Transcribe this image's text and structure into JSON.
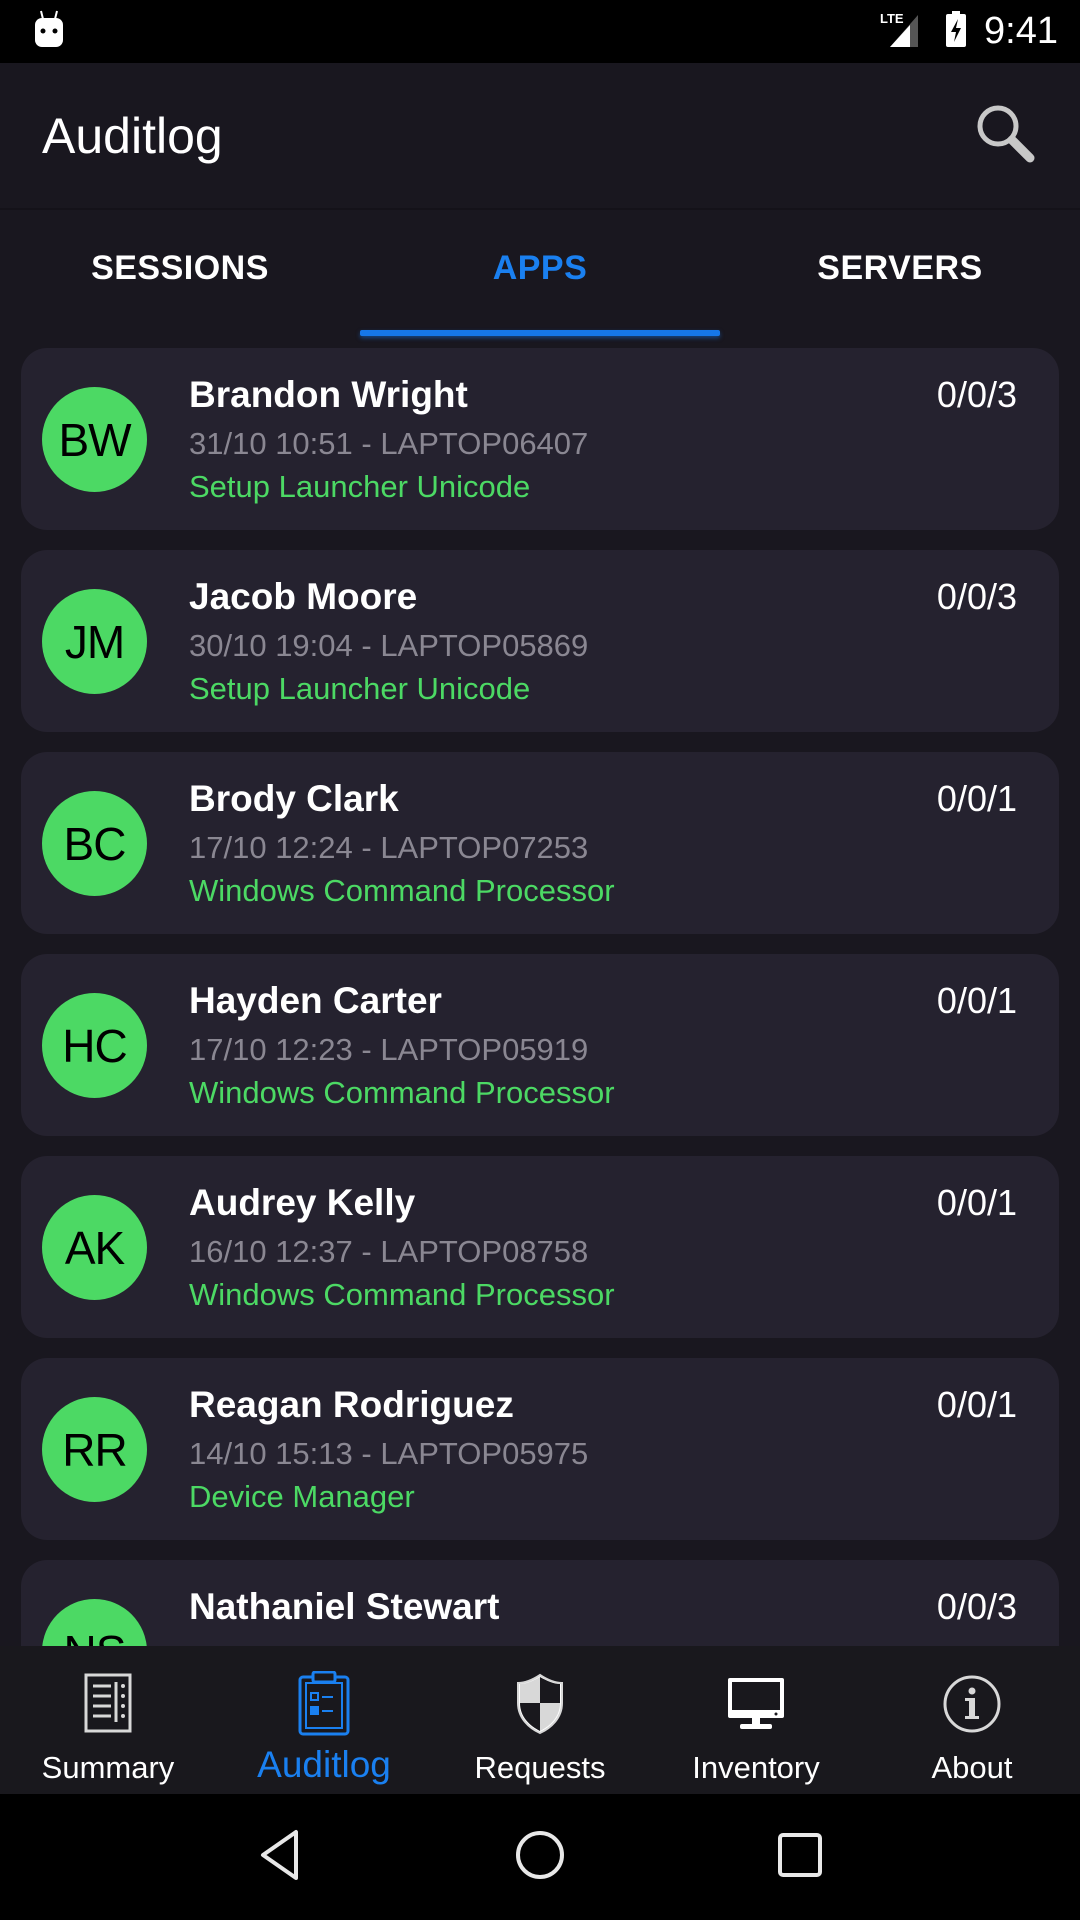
{
  "status_bar": {
    "network": "LTE",
    "time": "9:41"
  },
  "app_bar": {
    "title": "Auditlog",
    "search_icon": "search-icon"
  },
  "tabs": [
    {
      "label": "SESSIONS",
      "active": false
    },
    {
      "label": "APPS",
      "active": true
    },
    {
      "label": "SERVERS",
      "active": false
    }
  ],
  "entries": [
    {
      "initials": "BW",
      "name": "Brandon Wright",
      "meta": "31/10 10:51 - LAPTOP06407",
      "app": "Setup Launcher Unicode",
      "count": "0/0/3"
    },
    {
      "initials": "JM",
      "name": "Jacob Moore",
      "meta": "30/10 19:04 - LAPTOP05869",
      "app": "Setup Launcher Unicode",
      "count": "0/0/3"
    },
    {
      "initials": "BC",
      "name": "Brody Clark",
      "meta": "17/10 12:24 - LAPTOP07253",
      "app": "Windows Command Processor",
      "count": "0/0/1"
    },
    {
      "initials": "HC",
      "name": "Hayden Carter",
      "meta": "17/10 12:23 - LAPTOP05919",
      "app": "Windows Command Processor",
      "count": "0/0/1"
    },
    {
      "initials": "AK",
      "name": "Audrey Kelly",
      "meta": "16/10 12:37 - LAPTOP08758",
      "app": "Windows Command Processor",
      "count": "0/0/1"
    },
    {
      "initials": "RR",
      "name": "Reagan Rodriguez",
      "meta": "14/10 15:13 - LAPTOP05975",
      "app": "Device Manager",
      "count": "0/0/1"
    },
    {
      "initials": "NS",
      "name": "Nathaniel Stewart",
      "meta": "",
      "app": "",
      "count": "0/0/3"
    }
  ],
  "bottom_nav": [
    {
      "label": "Summary",
      "icon": "summary-icon",
      "active": false
    },
    {
      "label": "Auditlog",
      "icon": "clipboard-icon",
      "active": true
    },
    {
      "label": "Requests",
      "icon": "shield-icon",
      "active": false
    },
    {
      "label": "Inventory",
      "icon": "monitor-icon",
      "active": false
    },
    {
      "label": "About",
      "icon": "info-icon",
      "active": false
    }
  ],
  "colors": {
    "accent": "#1a80f0",
    "avatar": "#4cd964",
    "app_text": "#4cd964",
    "card_bg": "#25222f",
    "page_bg": "#19171f"
  }
}
